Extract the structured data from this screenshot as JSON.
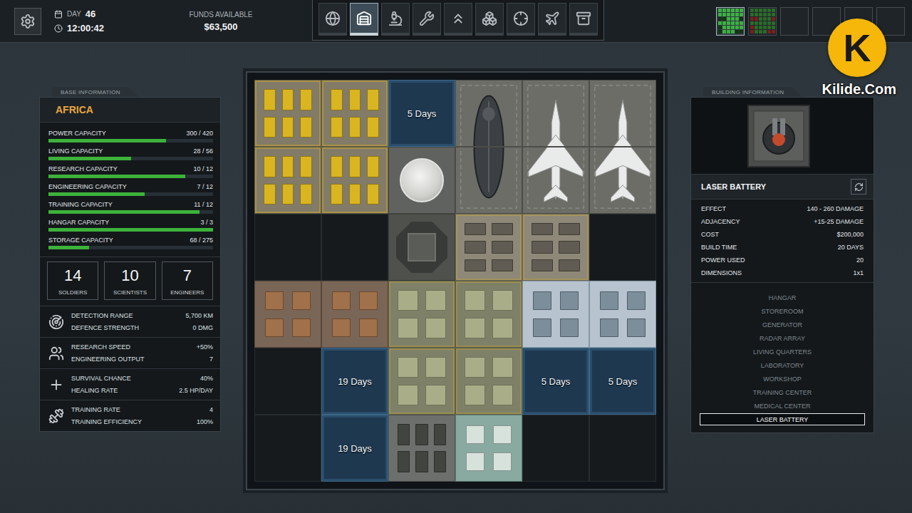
{
  "top_bar": {
    "day_label": "DAY",
    "day": "46",
    "time": "12:00:42",
    "funds_label": "FUNDS AVAILABLE",
    "funds": "$63,500"
  },
  "nav_tabs": [
    {
      "selected": false
    },
    {
      "selected": true
    },
    {
      "selected": false
    },
    {
      "selected": false
    },
    {
      "selected": false
    },
    {
      "selected": false
    },
    {
      "selected": false
    },
    {
      "selected": false
    },
    {
      "selected": false
    }
  ],
  "base_slots": [
    {
      "filled": true,
      "selected": true
    },
    {
      "filled": true,
      "selected": false
    },
    {
      "filled": false,
      "selected": false
    },
    {
      "filled": false,
      "selected": false
    },
    {
      "filled": false,
      "selected": false
    },
    {
      "filled": false,
      "selected": false
    }
  ],
  "base_info": {
    "header": "BASE INFORMATION",
    "name": "AFRICA",
    "capacities": [
      {
        "label": "POWER CAPACITY",
        "value": "300 / 420",
        "level": 0.714
      },
      {
        "label": "LIVING CAPACITY",
        "value": "28 / 56",
        "level": 0.5
      },
      {
        "label": "RESEARCH CAPACITY",
        "value": "10 / 12",
        "level": 0.833
      },
      {
        "label": "ENGINEERING CAPACITY",
        "value": "7 / 12",
        "level": 0.583
      },
      {
        "label": "TRAINING CAPACITY",
        "value": "11 / 12",
        "level": 0.917
      },
      {
        "label": "HANGAR CAPACITY",
        "value": "3 / 3",
        "level": 1
      },
      {
        "label": "STORAGE CAPACITY",
        "value": "68 / 275",
        "level": 0.247
      }
    ],
    "staff": [
      {
        "count": "14",
        "label": "SOLDIERS"
      },
      {
        "count": "10",
        "label": "SCIENTISTS"
      },
      {
        "count": "7",
        "label": "ENGINEERS"
      }
    ],
    "stat_groups": [
      {
        "rows": [
          {
            "label": "DETECTION RANGE",
            "value": "5,700 KM"
          },
          {
            "label": "DEFENCE STRENGTH",
            "value": "0 DMG"
          }
        ]
      },
      {
        "rows": [
          {
            "label": "RESEARCH SPEED",
            "value": "+50%"
          },
          {
            "label": "ENGINEERING OUTPUT",
            "value": "7"
          }
        ]
      },
      {
        "rows": [
          {
            "label": "SURVIVAL CHANCE",
            "value": "40%"
          },
          {
            "label": "HEALING RATE",
            "value": "2.5 HP/DAY"
          }
        ]
      },
      {
        "rows": [
          {
            "label": "TRAINING RATE",
            "value": "4"
          },
          {
            "label": "TRAINING EFFICIENCY",
            "value": "100%"
          }
        ]
      }
    ]
  },
  "base_grid": [
    [
      {
        "kind": "storage"
      },
      {
        "kind": "storage"
      },
      {
        "kind": "construction",
        "days": "5 Days"
      },
      {
        "kind": "hangar",
        "craft": "dropship",
        "segment": "top"
      },
      {
        "kind": "hangar",
        "craft": "fighter",
        "segment": "top"
      },
      {
        "kind": "hangar",
        "craft": "fighter",
        "segment": "top"
      }
    ],
    [
      {
        "kind": "storage"
      },
      {
        "kind": "storage"
      },
      {
        "kind": "radar"
      },
      {
        "kind": "hangar",
        "craft": "dropship",
        "segment": "bottom"
      },
      {
        "kind": "hangar",
        "craft": "fighter",
        "segment": "bottom"
      },
      {
        "kind": "hangar",
        "craft": "fighter",
        "segment": "bottom"
      }
    ],
    [
      {
        "kind": "empty"
      },
      {
        "kind": "empty"
      },
      {
        "kind": "lift"
      },
      {
        "kind": "workshop"
      },
      {
        "kind": "workshop"
      },
      {
        "kind": "empty"
      }
    ],
    [
      {
        "kind": "office"
      },
      {
        "kind": "office"
      },
      {
        "kind": "quarters"
      },
      {
        "kind": "quarters"
      },
      {
        "kind": "laboratory"
      },
      {
        "kind": "laboratory"
      }
    ],
    [
      {
        "kind": "empty"
      },
      {
        "kind": "construction",
        "days": "19 Days"
      },
      {
        "kind": "quarters"
      },
      {
        "kind": "quarters"
      },
      {
        "kind": "construction",
        "days": "5 Days"
      },
      {
        "kind": "construction",
        "days": "5 Days"
      }
    ],
    [
      {
        "kind": "empty"
      },
      {
        "kind": "construction",
        "days": "19 Days"
      },
      {
        "kind": "training"
      },
      {
        "kind": "medical"
      },
      {
        "kind": "empty"
      },
      {
        "kind": "empty"
      }
    ]
  ],
  "building_info": {
    "header": "BUILDING INFORMATION",
    "name": "LASER BATTERY",
    "stats": [
      {
        "label": "EFFECT",
        "value": "140 - 260 DAMAGE"
      },
      {
        "label": "ADJACENCY",
        "value": "+15-25 DAMAGE"
      },
      {
        "label": "COST",
        "value": "$200,000"
      },
      {
        "label": "BUILD TIME",
        "value": "20 DAYS"
      },
      {
        "label": "POWER USED",
        "value": "20"
      },
      {
        "label": "DIMENSIONS",
        "value": "1x1"
      }
    ],
    "buildings": [
      {
        "label": "HANGAR",
        "selected": false
      },
      {
        "label": "STOREROOM",
        "selected": false
      },
      {
        "label": "GENERATOR",
        "selected": false
      },
      {
        "label": "RADAR ARRAY",
        "selected": false
      },
      {
        "label": "LIVING QUARTERS",
        "selected": false
      },
      {
        "label": "LABORATORY",
        "selected": false
      },
      {
        "label": "WORKSHOP",
        "selected": false
      },
      {
        "label": "TRAINING CENTER",
        "selected": false
      },
      {
        "label": "MEDICAL CENTER",
        "selected": false
      },
      {
        "label": "LASER BATTERY",
        "selected": true
      }
    ]
  },
  "watermark": {
    "mark": "K",
    "text": "Kilide.Com"
  }
}
